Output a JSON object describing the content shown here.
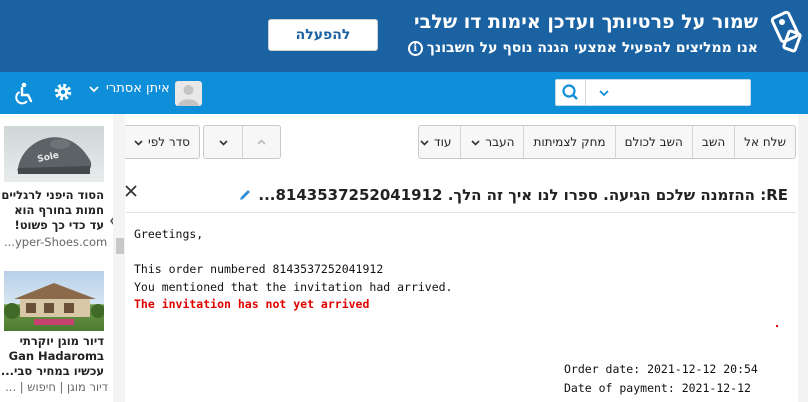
{
  "banner": {
    "title": "שמור על פרטיותך ועדכן אימות דו שלבי",
    "subtitle": "אנו ממליצים להפעיל אמצעי הגנה נוסף על חשבונך",
    "activate_label": "להפעלה"
  },
  "header": {
    "user_name": "איתן אסתרי",
    "search_placeholder": ""
  },
  "sidebar": {
    "ad1_text": "הסוד היפני לרגליים חמות בחורף הוא עד כדי כך פשוט!",
    "ad1_source": "...yper-Shoes.com",
    "ad1_logo": "Sole",
    "ad2_text": "דיור מוגן יוקרתי בGan Hadarom עכשיו במחיר סבי...",
    "ad2_source": "דיור מוגן | חיפוש | ..."
  },
  "toolbar": {
    "reply": "השב",
    "reply_all": "השב לכולם",
    "send_to": "שלח אל",
    "delete_attachments": "מחק לצמיתות",
    "move": "העבר",
    "more": "עוד",
    "sort_by": "סדר לפי"
  },
  "email": {
    "subject": "RE: ההזמנה שלכם הגיעה. ספרו לנו איך זה הלך. 8143537252041912...",
    "body_lines": [
      "Greetings,",
      "",
      "This order numbered 8143537252041912",
      "You mentioned that the invitation had arrived."
    ],
    "highlight_line": "The invitation has not yet arrived",
    "order_date": "Order date: 2021-12-12 20:54",
    "payment_date": "Date of payment: 2021-12-12"
  },
  "colors": {
    "banner_bg": "#1b62a3",
    "header_bg": "#0f8fd9",
    "highlight_red": "#e00000"
  }
}
